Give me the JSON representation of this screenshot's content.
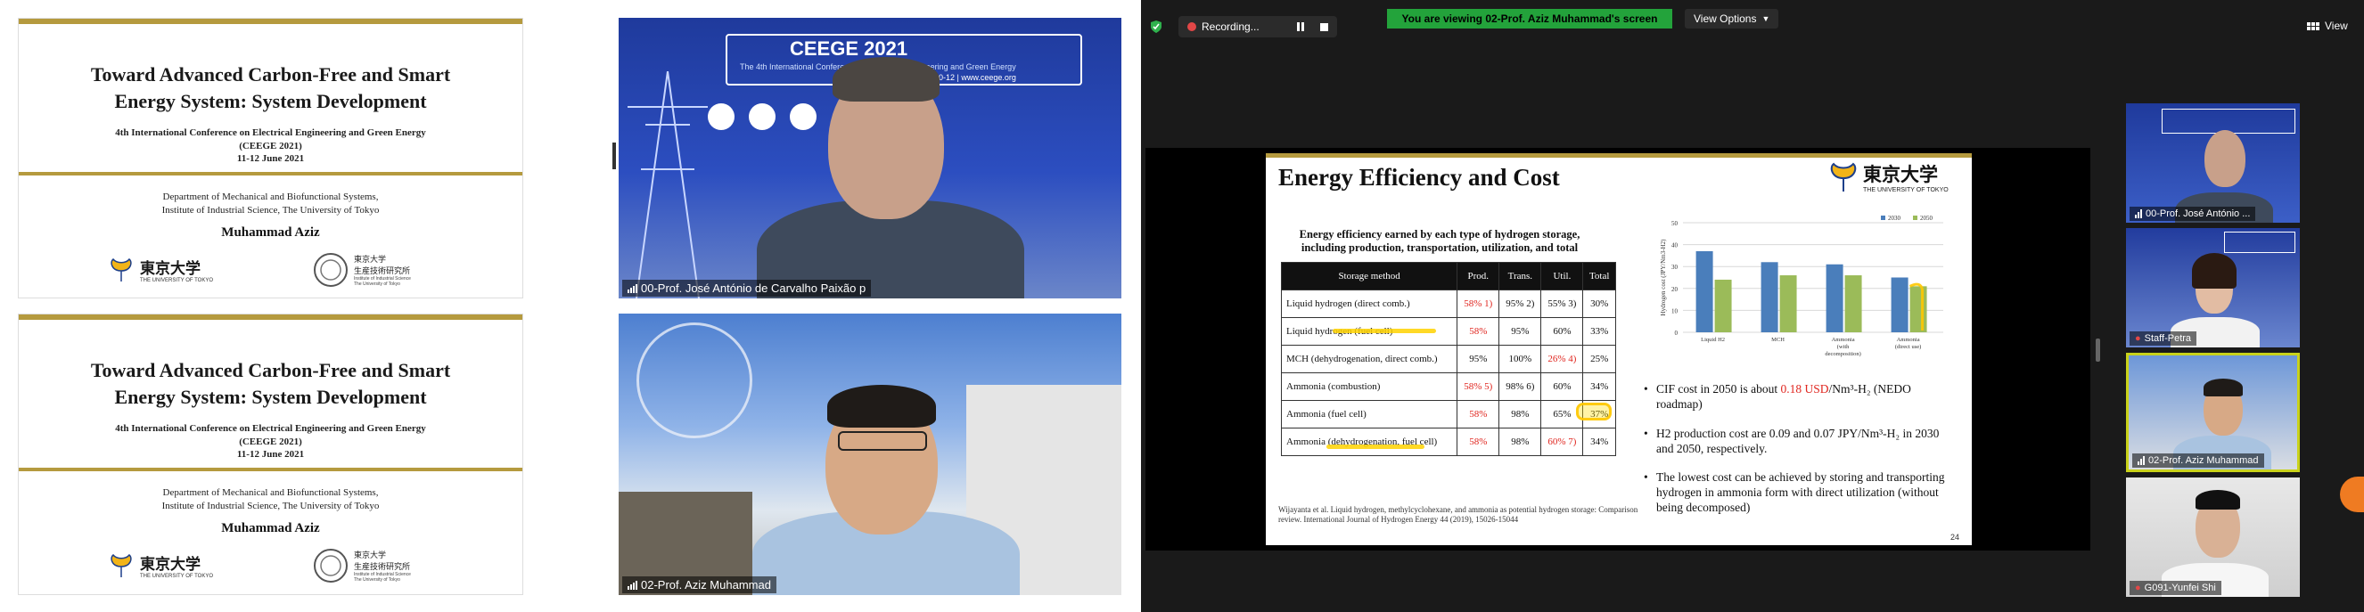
{
  "left_panel": {
    "slide": {
      "title_line1": "Toward Advanced Carbon-Free and Smart",
      "title_line2": "Energy System: System Development",
      "conference": "4th International Conference on Electrical Engineering and Green Energy",
      "acronym": "(CEEGE 2021)",
      "dates": "11-12 June 2021",
      "dept_line1": "Department of Mechanical and Biofunctional Systems,",
      "dept_line2": "Institute of Industrial Science, The University of Tokyo",
      "author": "Muhammad Aziz",
      "logo_text": "東京大学",
      "logo_sub": "THE UNIVERSITY OF TOKYO",
      "iis_text": "東京大学\n生産技術研究所",
      "iis_sub": "Institute of Industrial Science\nThe University of Tokyo"
    },
    "cam_top": {
      "name": "00-Prof. José António de Carvalho Paixão p",
      "banner_title": "CEEGE 2021",
      "banner_sub": "The 4th International Conference on Electrical Engineering and Green Energy",
      "banner_date": "June 10-12 | www.ceege.org"
    },
    "cam_bottom": {
      "name": "02-Prof. Aziz Muhammad"
    }
  },
  "zoom": {
    "recording_label": "Recording...",
    "viewing_banner": "You are viewing 02-Prof. Aziz Muhammad's screen",
    "view_options": "View Options",
    "view_toggle": "View",
    "shared_slide": {
      "title": "Energy Efficiency and Cost",
      "logo_text": "東京大学",
      "logo_sub": "THE UNIVERSITY OF TOKYO",
      "subtitle_line1": "Energy efficiency earned by each type of hydrogen storage,",
      "subtitle_line2": "including production, transportation, utilization, and total",
      "table_headers": [
        "Storage method",
        "Prod.",
        "Trans.",
        "Util.",
        "Total"
      ],
      "table_rows": [
        [
          "Liquid hydrogen (direct comb.)",
          "58% 1)",
          "95% 2)",
          "55% 3)",
          "30%"
        ],
        [
          "Liquid hydrogen (fuel cell)",
          "58%",
          "95%",
          "60%",
          "33%"
        ],
        [
          "MCH (dehydrogenation, direct comb.)",
          "95%",
          "100%",
          "26% 4)",
          "25%"
        ],
        [
          "Ammonia (combustion)",
          "58% 5)",
          "98% 6)",
          "60%",
          "34%"
        ],
        [
          "Ammonia (fuel cell)",
          "58%",
          "98%",
          "65%",
          "37%"
        ],
        [
          "Ammonia (dehydrogenation, fuel cell)",
          "58%",
          "98%",
          "60% 7)",
          "34%"
        ]
      ],
      "bullets": [
        "CIF cost in 2050 is about 0.18 USD/Nm³-H₂ (NEDO roadmap)",
        "H2 production cost are 0.09 and 0.07 JPY/Nm³-H₂ in 2030 and 2050, respectively.",
        "The lowest cost can be achieved by storing and transporting hydrogen in ammonia form with direct utilization (without being decomposed)"
      ],
      "bullet1_pre": "CIF cost in 2050 is about ",
      "bullet1_red": "0.18 USD",
      "bullet1_post": "/Nm³-H₂ (NEDO roadmap)",
      "reference": "Wijayanta et al. Liquid hydrogen, methylcyclohexane, and ammonia as potential hydrogen storage: Comparison review. International Journal of Hydrogen Energy 44 (2019), 15026-15044",
      "page_number": "24"
    },
    "participants": [
      {
        "name": "00-Prof. José António ..."
      },
      {
        "name": "Staff-Petra"
      },
      {
        "name": "02-Prof. Aziz Muhammad"
      },
      {
        "name": "G091-Yunfei Shi"
      }
    ]
  },
  "chart_data": {
    "type": "bar",
    "categories": [
      "Liquid H2",
      "MCH",
      "Ammonia (with decomposition)",
      "Ammonia (direct use)"
    ],
    "series": [
      {
        "name": "2030",
        "values": [
          37,
          32,
          31,
          25
        ],
        "color": "#4a7ebb"
      },
      {
        "name": "2050",
        "values": [
          24,
          26,
          26,
          21
        ],
        "color": "#9bbb59"
      }
    ],
    "ylabel": "Hydrogen cost (JPY/Nm3-H2)",
    "ylim": [
      0,
      50
    ],
    "yticks": [
      "0",
      "10",
      "20",
      "30",
      "40",
      "50"
    ],
    "legend": "top-right",
    "grid": true
  }
}
